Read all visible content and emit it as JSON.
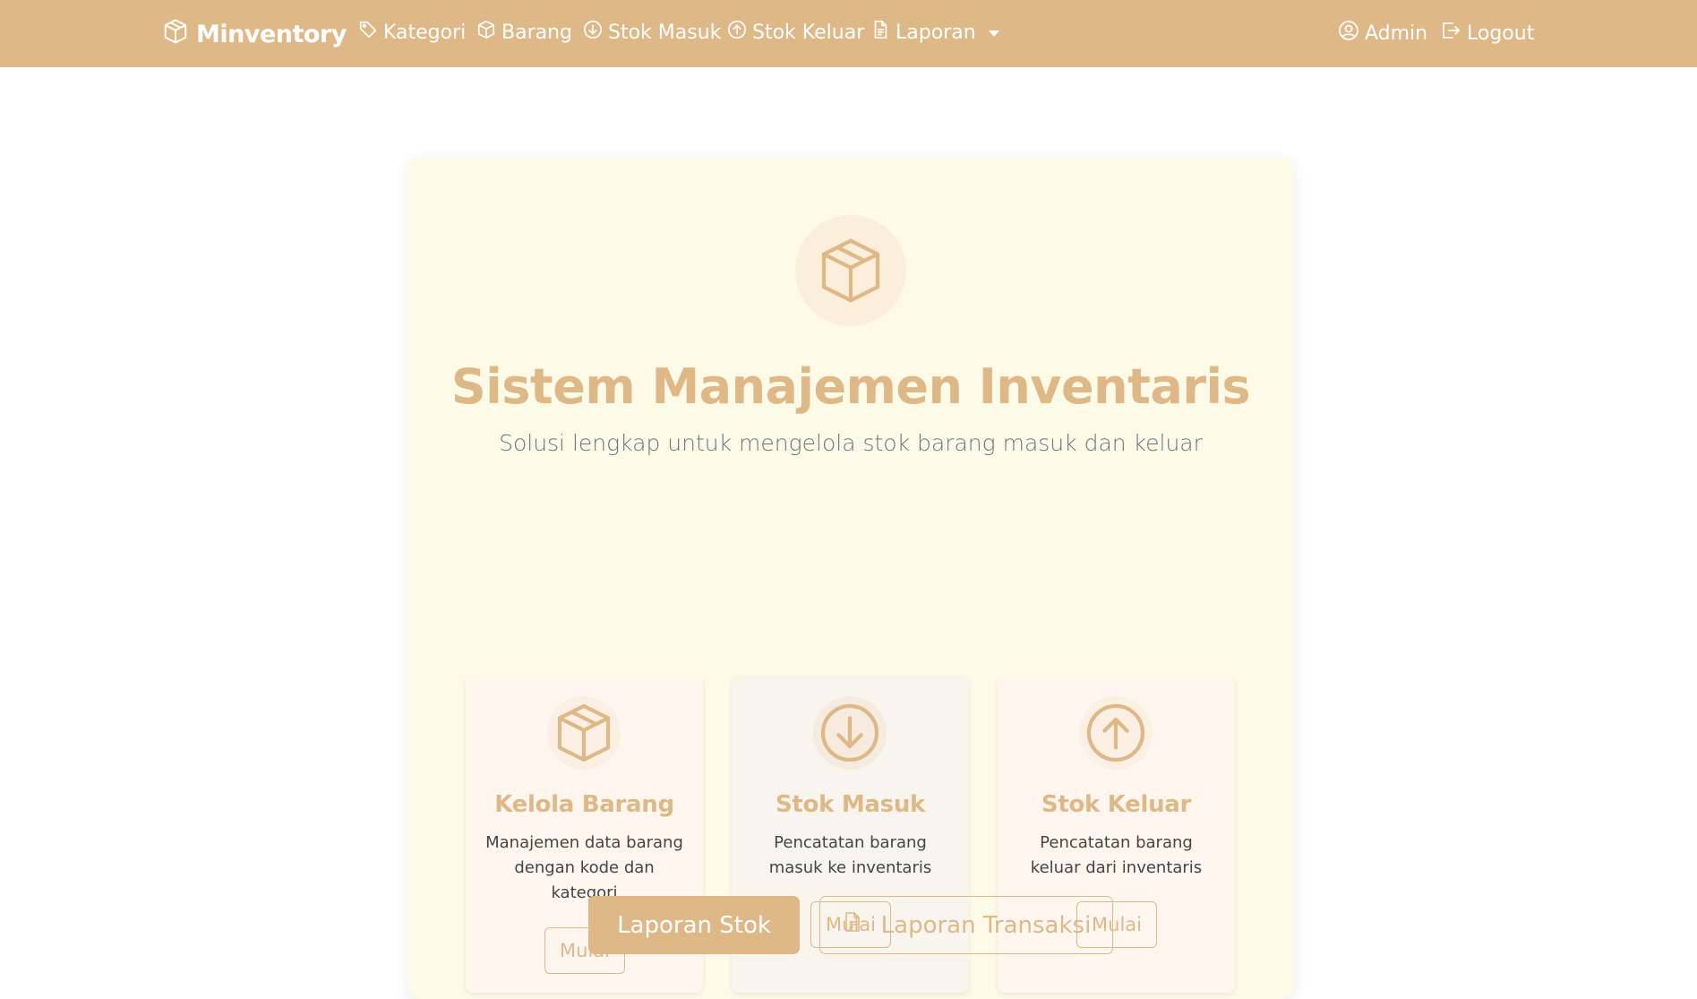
{
  "navbar": {
    "brand": "Minventory",
    "items": [
      {
        "label": "Kategori",
        "icon": "tag-icon"
      },
      {
        "label": "Barang",
        "icon": "box-icon"
      },
      {
        "label": "Stok Masuk",
        "icon": "arrow-down-circle-icon"
      },
      {
        "label": "Stok Keluar",
        "icon": "arrow-up-circle-icon"
      },
      {
        "label": "Laporan",
        "icon": "document-icon"
      }
    ],
    "user": {
      "label": "Admin",
      "icon": "person-circle-icon"
    },
    "logout": {
      "label": "Logout",
      "icon": "logout-icon"
    }
  },
  "hero": {
    "icon": "box-icon",
    "title": "Sistem Manajemen Inventaris",
    "subtitle": "Solusi lengkap untuk mengelola stok barang masuk dan keluar"
  },
  "features": [
    {
      "title": "Kelola Barang",
      "description": "Manajemen data barang dengan kode dan kategori",
      "button": "Mulai",
      "icon": "box-icon"
    },
    {
      "title": "Stok Masuk",
      "description": "Pencatatan barang masuk ke inventaris",
      "button": "Mulai",
      "icon": "arrow-down-circle-icon"
    },
    {
      "title": "Stok Keluar",
      "description": "Pencatatan barang keluar dari inventaris",
      "button": "Mulai",
      "icon": "arrow-up-circle-icon"
    }
  ],
  "actions": {
    "stock_report": "Laporan Stok",
    "transaction_report": "Laporan Transaksi"
  },
  "colors": {
    "primary": "#dfb887",
    "hero_bg": "#fefae8",
    "text_muted": "#6c757d"
  }
}
